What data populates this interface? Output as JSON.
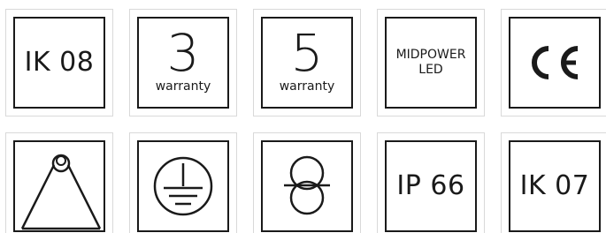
{
  "row1": {
    "tile1": {
      "text": "IK 08"
    },
    "tile2": {
      "number": "3",
      "label": "warranty"
    },
    "tile3": {
      "number": "5",
      "label": "warranty"
    },
    "tile4": {
      "line1": "MIDPOWER",
      "line2": "LED"
    },
    "tile5": {
      "icon": "ce-mark-icon"
    }
  },
  "row2": {
    "tile1": {
      "icon": "ceiling-light-beam-icon"
    },
    "tile2": {
      "icon": "protective-earth-icon"
    },
    "tile3": {
      "icon": "safety-transformer-icon"
    },
    "tile4": {
      "text": "IP 66"
    },
    "tile5": {
      "text": "IK 07"
    }
  }
}
